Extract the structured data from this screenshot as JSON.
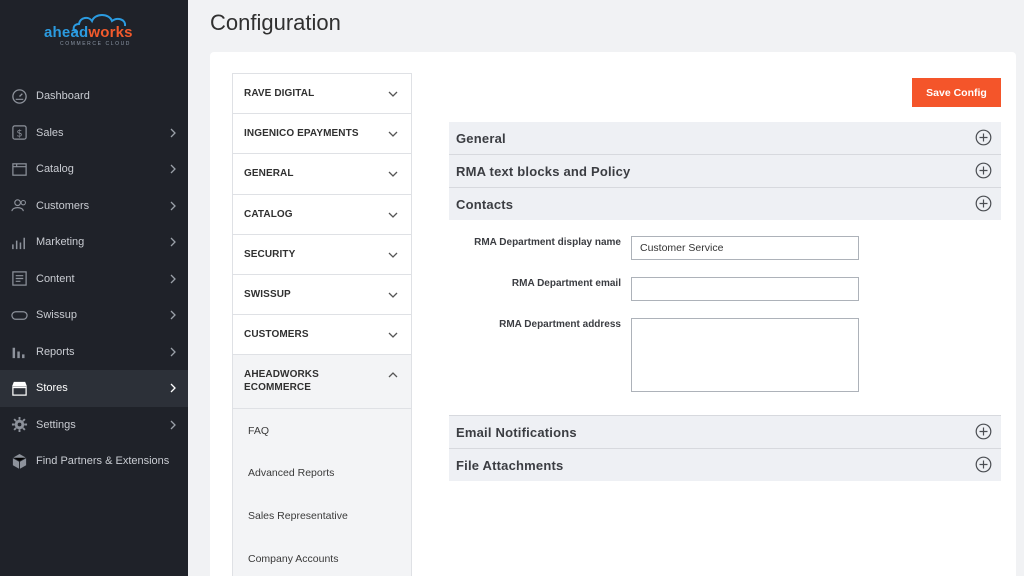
{
  "brand": {
    "logo_part1": "ahead",
    "logo_part2": "works",
    "logo_sub": "COMMERCE CLOUD"
  },
  "sidebar": {
    "items": [
      {
        "label": "Dashboard",
        "icon": "dashboard-icon",
        "chevron": false,
        "active": false
      },
      {
        "label": "Sales",
        "icon": "dollar-icon",
        "chevron": true,
        "active": false
      },
      {
        "label": "Catalog",
        "icon": "catalog-icon",
        "chevron": true,
        "active": false
      },
      {
        "label": "Customers",
        "icon": "users-icon",
        "chevron": true,
        "active": false
      },
      {
        "label": "Marketing",
        "icon": "marketing-icon",
        "chevron": true,
        "active": false
      },
      {
        "label": "Content",
        "icon": "content-icon",
        "chevron": true,
        "active": false
      },
      {
        "label": "Swissup",
        "icon": "swissup-icon",
        "chevron": true,
        "active": false
      },
      {
        "label": "Reports",
        "icon": "reports-icon",
        "chevron": true,
        "active": false
      },
      {
        "label": "Stores",
        "icon": "store-icon",
        "chevron": true,
        "active": true
      },
      {
        "label": "Settings",
        "icon": "gear-icon",
        "chevron": true,
        "active": false
      },
      {
        "label": "Find Partners & Extensions",
        "icon": "cube-icon",
        "chevron": false,
        "active": false
      }
    ]
  },
  "page": {
    "title": "Configuration",
    "save_label": "Save Config"
  },
  "tabs": {
    "items": [
      {
        "label": "RAVE DIGITAL"
      },
      {
        "label": "INGENICO EPAYMENTS"
      },
      {
        "label": "GENERAL"
      },
      {
        "label": "CATALOG"
      },
      {
        "label": "SECURITY"
      },
      {
        "label": "SWISSUP"
      },
      {
        "label": "CUSTOMERS"
      }
    ],
    "open": {
      "label_line1": "AHEADWORKS",
      "label_line2": "ECOMMERCE",
      "subitems": [
        "FAQ",
        "Advanced Reports",
        "Sales Representative",
        "Company Accounts"
      ]
    }
  },
  "sections": {
    "general": "General",
    "rma_text": "RMA text blocks and Policy",
    "contacts": "Contacts",
    "email_notifications": "Email Notifications",
    "file_attachments": "File Attachments"
  },
  "contacts": {
    "display_name_label": "RMA Department display name",
    "display_name_value": "Customer Service",
    "email_label": "RMA Department email",
    "email_value": "",
    "address_label": "RMA Department address",
    "address_value": ""
  },
  "colors": {
    "accent": "#f4552a",
    "sidebar_bg": "#1f2229",
    "brand_blue": "#2b9be0"
  }
}
